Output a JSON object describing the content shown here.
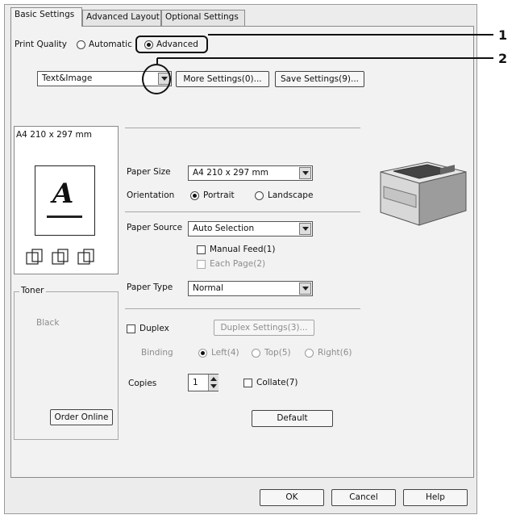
{
  "tabs": [
    {
      "label": "Basic Settings"
    },
    {
      "label": "Advanced Layout"
    },
    {
      "label": "Optional Settings"
    }
  ],
  "print_quality": {
    "label": "Print Quality",
    "automatic_label": "Automatic",
    "advanced_label": "Advanced",
    "selected": "Advanced"
  },
  "mode_select": {
    "value": "Text&Image"
  },
  "more_settings_button": "More Settings(0)...",
  "save_settings_button": "Save Settings(9)...",
  "preview": {
    "paper_label": "A4 210 x 297 mm",
    "sample_letter": "A"
  },
  "paper_size": {
    "label": "Paper Size",
    "value": "A4 210 x 297 mm"
  },
  "orientation": {
    "label": "Orientation",
    "portrait": "Portrait",
    "landscape": "Landscape",
    "selected": "Portrait"
  },
  "paper_source": {
    "label": "Paper Source",
    "value": "Auto Selection"
  },
  "manual_feed": {
    "label": "Manual Feed(1)",
    "checked": false
  },
  "each_page": {
    "label": "Each Page(2)",
    "checked": false,
    "enabled": false
  },
  "paper_type": {
    "label": "Paper Type",
    "value": "Normal"
  },
  "toner": {
    "group_label": "Toner",
    "value": "Black"
  },
  "order_online_button": "Order Online",
  "duplex": {
    "label": "Duplex",
    "checked": false,
    "settings_button": "Duplex Settings(3)..."
  },
  "binding": {
    "label": "Binding",
    "left": "Left(4)",
    "top": "Top(5)",
    "right": "Right(6)",
    "selected": "Left(4)"
  },
  "copies": {
    "label": "Copies",
    "value": "1"
  },
  "collate": {
    "label": "Collate(7)",
    "checked": false
  },
  "default_button": "Default",
  "dialog_buttons": {
    "ok": "OK",
    "cancel": "Cancel",
    "help": "Help"
  },
  "callouts": {
    "one": "1",
    "two": "2"
  }
}
